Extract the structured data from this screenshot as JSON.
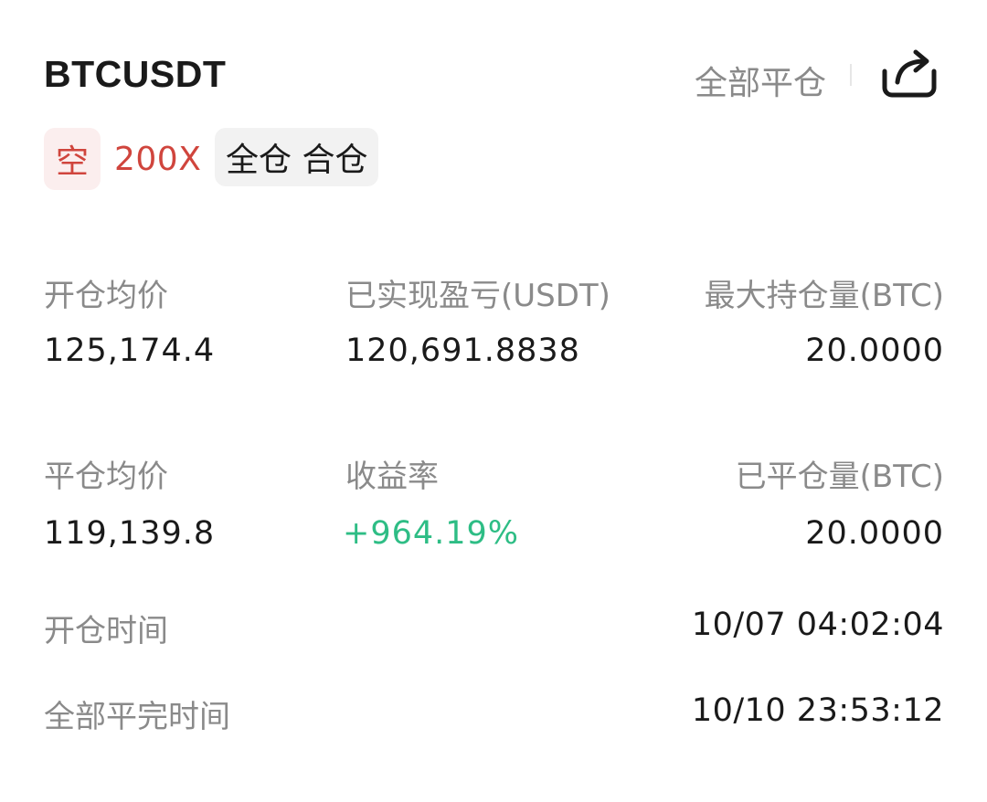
{
  "header": {
    "symbol": "BTCUSDT",
    "close_all_label": "全部平仓"
  },
  "tags": {
    "side": "空",
    "leverage": "200X",
    "margin_mode": "全仓 合仓"
  },
  "stats": {
    "open_avg_price_label": "开仓均价",
    "open_avg_price": "125,174.4",
    "realized_pnl_label": "已实现盈亏(USDT)",
    "realized_pnl": "120,691.8838",
    "max_position_label": "最大持仓量(BTC)",
    "max_position": "20.0000",
    "close_avg_price_label": "平仓均价",
    "close_avg_price": "119,139.8",
    "roi_label": "收益率",
    "roi": "+964.19%",
    "closed_amount_label": "已平仓量(BTC)",
    "closed_amount": "20.0000",
    "open_time_label": "开仓时间",
    "open_time": "10/07 04:02:04",
    "close_time_label": "全部平完时间",
    "close_time": "10/10 23:53:12"
  },
  "colors": {
    "short_red": "#d0453d",
    "short_bg": "#fbeeee",
    "profit_green": "#2ebd85",
    "muted_text": "#8a8a8a",
    "primary_text": "#1a1a1a",
    "chip_bg": "#f2f2f2"
  },
  "icons": {
    "share": "share-icon"
  }
}
